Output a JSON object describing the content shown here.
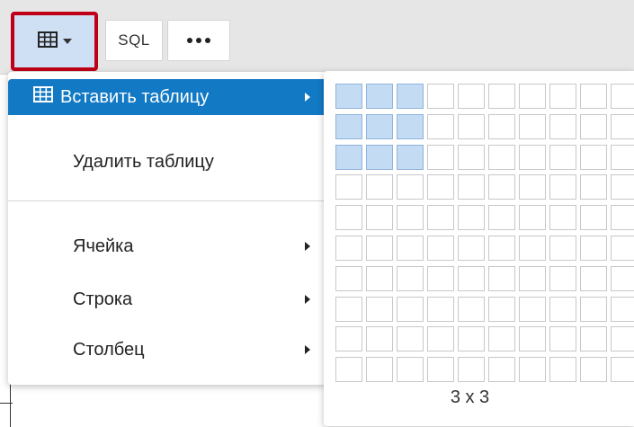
{
  "toolbar": {
    "table_button_icon": "table-grid-icon",
    "table_button_caret": "caret-down-icon",
    "sql_label": "SQL",
    "more_icon": "more-dots-icon",
    "highlight_color": "#c00016"
  },
  "menu": {
    "items": [
      {
        "label": "Вставить таблицу",
        "icon": "table-grid-icon",
        "has_submenu": true,
        "active": true
      },
      {
        "label": "Удалить таблицу",
        "has_submenu": false,
        "active": false
      },
      {
        "label": "Ячейка",
        "has_submenu": true,
        "active": false
      },
      {
        "label": "Строка",
        "has_submenu": true,
        "active": false
      },
      {
        "label": "Столбец",
        "has_submenu": true,
        "active": false
      }
    ],
    "active_color": "#1279c4"
  },
  "picker": {
    "visible_columns": 10,
    "rows": 10,
    "selected_rows": 3,
    "selected_columns": 3,
    "size_label": "3 x 3",
    "selected_color": "#c4dbf4"
  }
}
